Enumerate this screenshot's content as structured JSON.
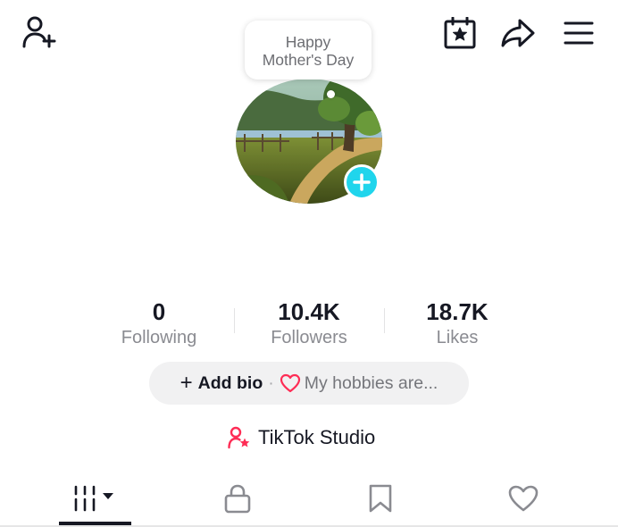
{
  "header": {
    "icons": [
      "add-user-icon",
      "calendar-star-icon",
      "share-icon",
      "menu-icon"
    ]
  },
  "note": {
    "line1": "Happy",
    "line2": "Mother's Day"
  },
  "avatar": {
    "add_icon": "plus-icon",
    "accent_color": "#20d5ec"
  },
  "stats": [
    {
      "value": "0",
      "label": "Following"
    },
    {
      "value": "10.4K",
      "label": "Followers"
    },
    {
      "value": "18.7K",
      "label": "Likes"
    }
  ],
  "bio": {
    "plus": "+",
    "add_label": "Add bio",
    "separator": "·",
    "hint": "My hobbies are...",
    "heart_color": "#fe2c55"
  },
  "studio": {
    "label": "TikTok Studio",
    "icon": "person-star-icon",
    "icon_color": "#fe2c55"
  },
  "tabs": [
    {
      "icon": "videos-grid-icon",
      "active": true
    },
    {
      "icon": "lock-icon",
      "active": false
    },
    {
      "icon": "bookmark-icon",
      "active": false
    },
    {
      "icon": "heart-icon",
      "active": false
    }
  ]
}
